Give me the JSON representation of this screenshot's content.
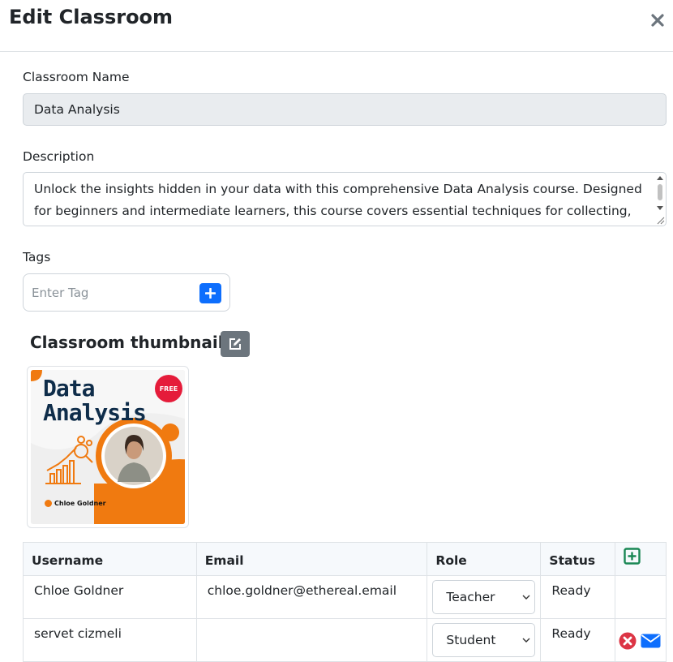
{
  "modal": {
    "title": "Edit Classroom"
  },
  "form": {
    "name_label": "Classroom Name",
    "name_value": "Data Analysis",
    "description_label": "Description",
    "description_value": "Unlock the insights hidden in your data with this comprehensive Data Analysis course. Designed for beginners and intermediate learners, this course covers essential techniques for collecting,",
    "tags_label": "Tags",
    "tag_placeholder": "Enter Tag"
  },
  "thumbnail": {
    "title": "Classroom thumbnail",
    "image_title_line1": "Data",
    "image_title_line2": "Analysis",
    "image_badge": "FREE",
    "image_author": "Chloe Goldner"
  },
  "table": {
    "headers": [
      "Username",
      "Email",
      "Role",
      "Status"
    ],
    "role_options": [
      "Teacher",
      "Student"
    ],
    "rows": [
      {
        "username": "Chloe Goldner",
        "email": "chloe.goldner@ethereal.email",
        "role": "Teacher",
        "status": "Ready"
      },
      {
        "username": "servet cizmeli",
        "email": "",
        "role": "Student",
        "status": "Ready"
      }
    ]
  },
  "icons": {
    "close": "close-icon",
    "tag_add": "plus-icon",
    "thumbnail_edit": "edit-icon",
    "add_user": "plus-square-icon",
    "remove_user": "remove-circle-icon",
    "email_user": "envelope-icon"
  },
  "colors": {
    "primary": "#0d6efd",
    "secondary": "#6c757d",
    "success": "#198754",
    "danger": "#dc3545",
    "readonly_bg": "#e9ecef",
    "border": "#dee2e6"
  }
}
